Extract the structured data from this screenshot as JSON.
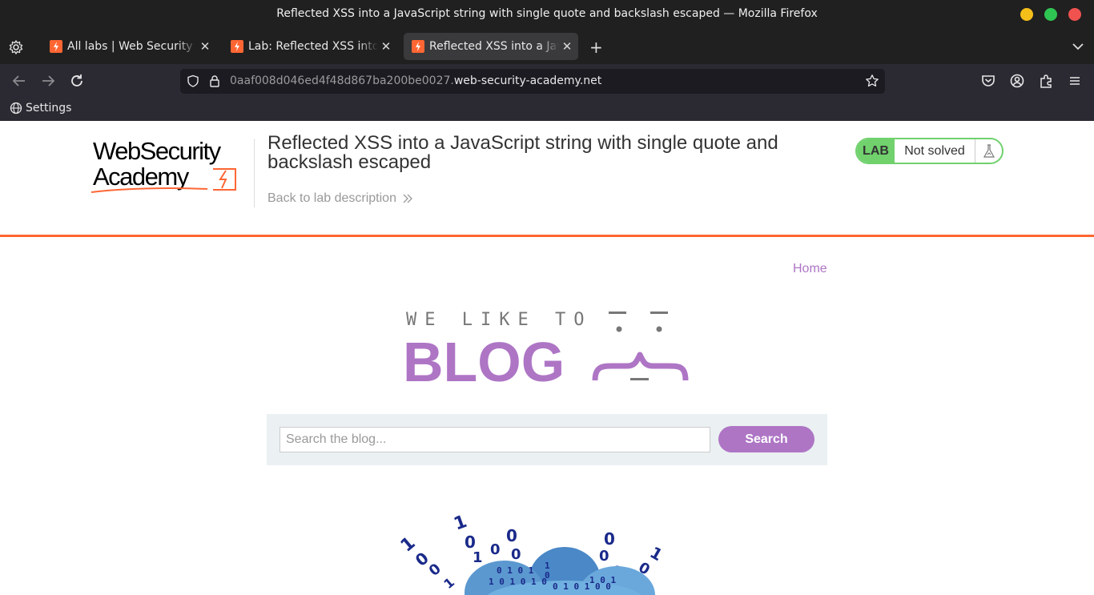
{
  "window": {
    "title": "Reflected XSS into a JavaScript string with single quote and backslash escaped — Mozilla Firefox"
  },
  "tabs": [
    {
      "label": "All labs | Web Security Academy",
      "active": false
    },
    {
      "label": "Lab: Reflected XSS into a JavaScript string",
      "active": false
    },
    {
      "label": "Reflected XSS into a JavaScript string",
      "active": true
    }
  ],
  "urlbar": {
    "subdomain": "0aaf008d046ed4f48d867ba200be0027.",
    "host": "web-security-academy.net"
  },
  "bookmarks": [
    {
      "label": "Settings"
    }
  ],
  "lab_header": {
    "logo_text_line1": "WebSecurity",
    "logo_text_line2": "Academy",
    "title": "Reflected XSS into a JavaScript string with single quote and backslash escaped",
    "back_link": "Back to lab description",
    "status_tag": "LAB",
    "status_text": "Not solved"
  },
  "nav": {
    "home": "Home"
  },
  "blog_logo": {
    "tagline": "WE LIKE TO",
    "word": "BLOG"
  },
  "search": {
    "placeholder": "Search the blog...",
    "button": "Search"
  },
  "colors": {
    "accent_purple": "#ae75c5",
    "header_orange": "#ff6633",
    "lab_green": "#70d16d"
  }
}
